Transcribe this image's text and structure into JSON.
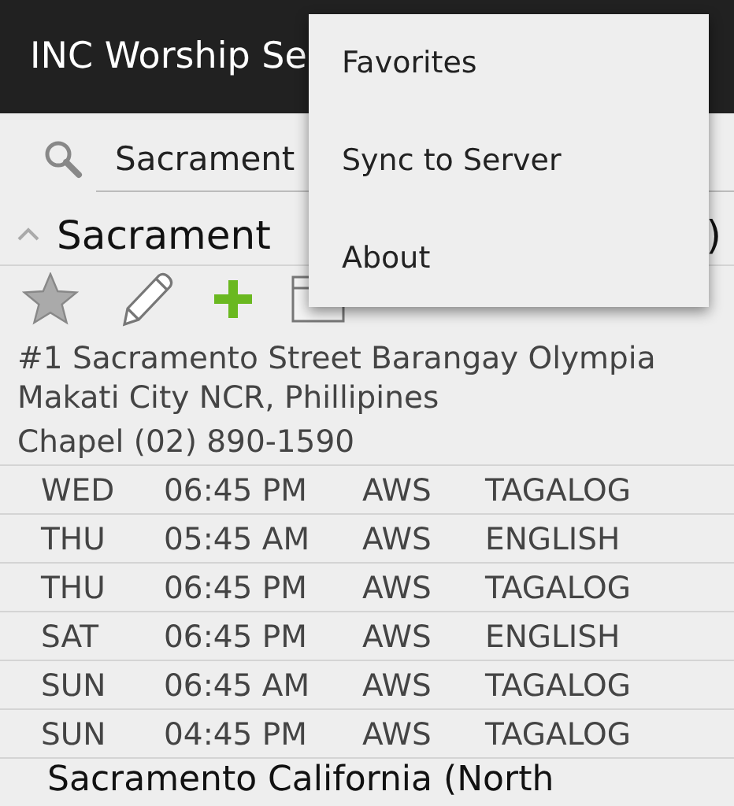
{
  "app_bar": {
    "title": "INC Worship Se"
  },
  "search": {
    "value": "Sacrament"
  },
  "group": {
    "title": "Sacrament",
    "tail": ")",
    "expanded": true
  },
  "address": "#1 Sacramento Street Barangay Olympia Makati City NCR, Phillipines",
  "contact": "Chapel  (02) 890-1590",
  "schedule": [
    {
      "day": "WED",
      "time": "06:45 PM",
      "type": "AWS",
      "language": "TAGALOG"
    },
    {
      "day": "THU",
      "time": "05:45 AM",
      "type": "AWS",
      "language": "ENGLISH"
    },
    {
      "day": "THU",
      "time": "06:45 PM",
      "type": "AWS",
      "language": "TAGALOG"
    },
    {
      "day": "SAT",
      "time": "06:45 PM",
      "type": "AWS",
      "language": "ENGLISH"
    },
    {
      "day": "SUN",
      "time": "06:45 AM",
      "type": "AWS",
      "language": "TAGALOG"
    },
    {
      "day": "SUN",
      "time": "04:45 PM",
      "type": "AWS",
      "language": "TAGALOG"
    }
  ],
  "next_group": {
    "title": "Sacramento California (North"
  },
  "menu": [
    "Favorites",
    "Sync to Server",
    "About"
  ]
}
